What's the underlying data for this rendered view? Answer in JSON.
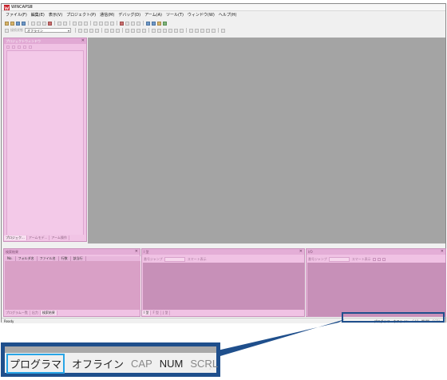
{
  "window": {
    "title": "WINCAPSⅢ"
  },
  "menu": [
    "ファイル(F)",
    "編集(E)",
    "表示(V)",
    "プロジェクト(P)",
    "通信(M)",
    "デバッグ(D)",
    "アーム(A)",
    "ツール(T)",
    "ウィンドウ(W)",
    "ヘルプ(H)"
  ],
  "toolbar": {
    "status_label": "接続状態",
    "status_value": "オフライン"
  },
  "project_window": {
    "title": "プロジェクトウィンドウ",
    "tabs": [
      "プロジェク...",
      "アームモデ...",
      "アーム操作"
    ]
  },
  "search_pane": {
    "title": "検索結果",
    "columns": [
      "No.",
      "フォルダ名",
      "ファイル名",
      "行数",
      "該当行"
    ],
    "tabs": [
      "プログラム一覧",
      "出力",
      "検索結果"
    ]
  },
  "i_pane": {
    "title": "I 型",
    "jump_label": "番号ジャンプ",
    "smart_label": "スマート表示",
    "tabs": [
      "I 型",
      "F 型",
      "J 型"
    ]
  },
  "io_pane": {
    "title": "I/O",
    "jump_label": "番号ジャンプ",
    "smart_label": "スマート表示"
  },
  "statusbar": {
    "ready": "Ready",
    "mode": "プログラマ",
    "state": "オフライン",
    "cap": "CAP",
    "num": "NUM",
    "scrl": "SCRL"
  },
  "colors": {
    "pane_pink": "#f0c2e4",
    "pane_dark_pink": "#c790b8",
    "main_area": "#a4a4a4",
    "callout_blue": "#1f4f8c",
    "highlight_cyan": "#29a5e6"
  }
}
